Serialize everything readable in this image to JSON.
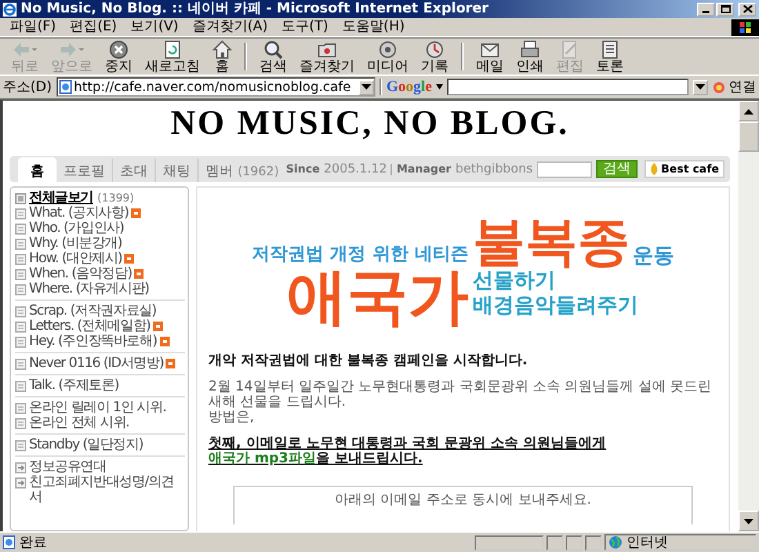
{
  "window": {
    "title": "No Music, No Blog. :: 네이버 카페 - Microsoft Internet Explorer"
  },
  "menu": [
    "파일(F)",
    "편집(E)",
    "보기(V)",
    "즐겨찾기(A)",
    "도구(T)",
    "도움말(H)"
  ],
  "toolbar": [
    [
      {
        "label": "뒤로",
        "disabled": true
      },
      {
        "label": "앞으로",
        "disabled": true
      },
      {
        "label": "중지",
        "disabled": false
      },
      {
        "label": "새로고침",
        "disabled": false
      },
      {
        "label": "홈",
        "disabled": false
      }
    ],
    [
      {
        "label": "검색",
        "disabled": false
      },
      {
        "label": "즐겨찾기",
        "disabled": false
      },
      {
        "label": "미디어",
        "disabled": false
      },
      {
        "label": "기록",
        "disabled": false
      }
    ],
    [
      {
        "label": "메일",
        "disabled": false
      },
      {
        "label": "인쇄",
        "disabled": false
      },
      {
        "label": "편집",
        "disabled": true
      },
      {
        "label": "토론",
        "disabled": false
      }
    ]
  ],
  "address": {
    "label": "주소(D)",
    "url": "http://cafe.naver.com/nomusicnoblog.cafe"
  },
  "google": {
    "label": "Google"
  },
  "links": {
    "label": "연결"
  },
  "cafe": {
    "title": "NO MUSIC, NO BLOG.",
    "tabs": [
      {
        "label": "홈",
        "selected": true
      },
      {
        "label": "프로필",
        "selected": false
      },
      {
        "label": "초대",
        "selected": false
      },
      {
        "label": "채팅",
        "selected": false
      },
      {
        "label": "멤버",
        "count": "(1962)",
        "selected": false
      }
    ],
    "since_label": "Since",
    "since": "2005.1.12",
    "manager_label": "Manager",
    "manager": "bethgibbons",
    "search_button": "검색",
    "best_button": "Best cafe"
  },
  "sidebar": [
    [
      {
        "kind": "all",
        "label": "전체글보기",
        "count": "(1399)",
        "new": false
      },
      {
        "kind": "board",
        "label": "What. (공지사항)",
        "new": true
      },
      {
        "kind": "board",
        "label": "Who. (가입인사)",
        "new": false
      },
      {
        "kind": "board",
        "label": "Why. (비분강개)",
        "new": false
      },
      {
        "kind": "board",
        "label": "How. (대안제시)",
        "new": true
      },
      {
        "kind": "board",
        "label": "When. (음악정담)",
        "new": true
      },
      {
        "kind": "board",
        "label": "Where. (자유게시판)",
        "new": false
      }
    ],
    [
      {
        "kind": "board",
        "label": "Scrap. (저작권자료실)",
        "new": false
      },
      {
        "kind": "board",
        "label": "Letters. (전체메일함)",
        "new": true
      },
      {
        "kind": "board",
        "label": "Hey. (주인장똑바로해)",
        "new": true
      }
    ],
    [
      {
        "kind": "board",
        "label": "Never 0116 (ID서명방)",
        "new": true
      }
    ],
    [
      {
        "kind": "board",
        "label": "Talk. (주제토론)",
        "new": false
      }
    ],
    [
      {
        "kind": "board",
        "label": "온라인 릴레이 1인 시위.",
        "new": false
      },
      {
        "kind": "board",
        "label": "온라인 전체 시위.",
        "new": false
      }
    ],
    [
      {
        "kind": "board",
        "label": "Standby (일단정지)",
        "new": false
      }
    ],
    [
      {
        "kind": "link",
        "label": "정보공유연대",
        "new": false
      },
      {
        "kind": "link",
        "label": "친고죄폐지반대성명/의견서",
        "new": false
      }
    ]
  ],
  "main": {
    "banner": [
      {
        "text": "저작권법 개정 위한 네티즌",
        "color": "#2f97d6"
      },
      {
        "text": "불복종",
        "color": "#f0561e"
      },
      {
        "text": "운동",
        "color": "#2f97d6"
      },
      {
        "text": "애국가",
        "color": "#f0561e"
      },
      {
        "text": "선물하기",
        "color": "#26a2c9"
      },
      {
        "text": "배경음악들려주기",
        "color": "#26a2c9"
      }
    ],
    "heading": "개악 저작권법에 대한 불복종 캠페인을 시작합니다.",
    "paragraph": "2월 14일부터 일주일간 노무현대통령과 국회문광위 소속 의원님들께 설에 못드린 새해 선물을 드립시다.",
    "method": "방법은,",
    "step": {
      "before": "첫째, 이메일로 노무현 대통령과 국회 문광위 소속 의원님들에게 ",
      "link": "애국가 mp3파일",
      "after": "을 보내드립시다."
    },
    "box_text": "아래의 이메일 주소로 동시에 보내주세요."
  },
  "status": {
    "text": "완료",
    "zone": "인터넷"
  }
}
